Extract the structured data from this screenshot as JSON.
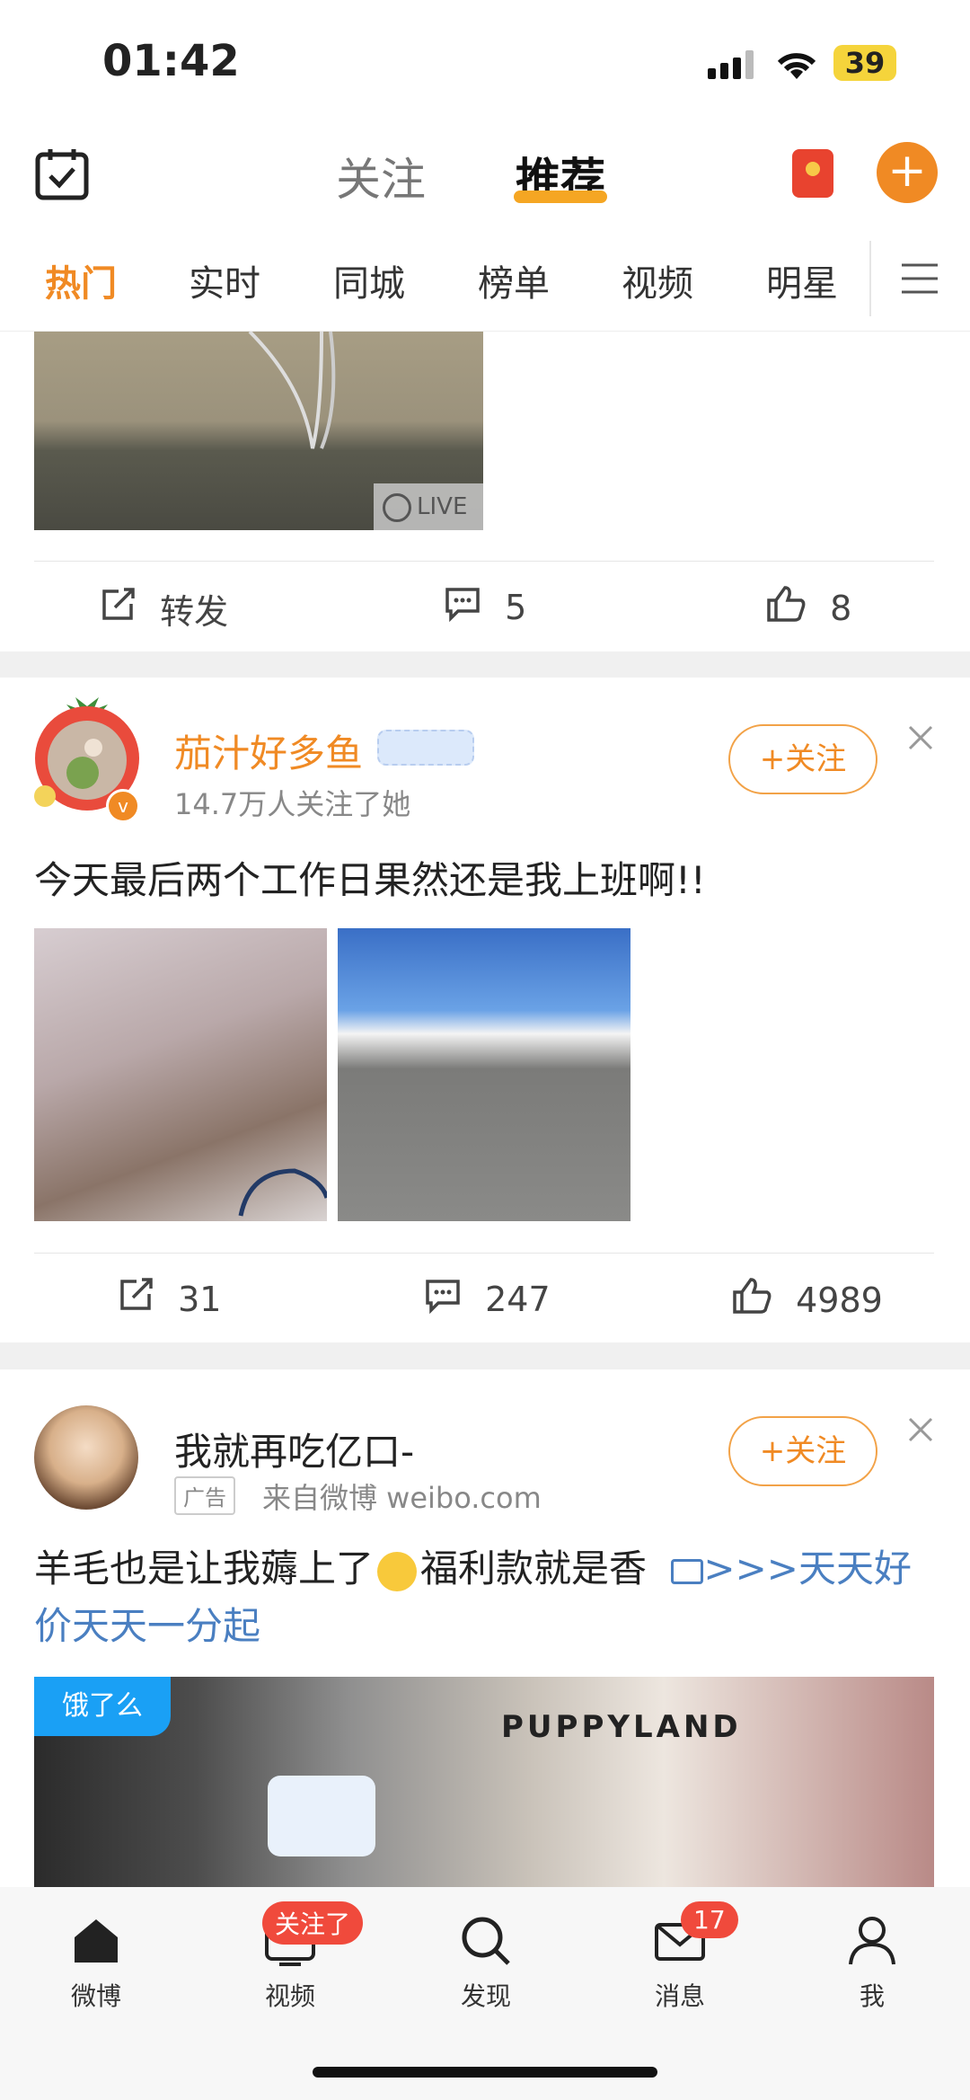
{
  "status": {
    "time": "01:42",
    "battery": "39"
  },
  "header": {
    "tab_follow": "关注",
    "tab_recommend": "推荐",
    "accent": "#f08a24"
  },
  "channels": [
    "热门",
    "实时",
    "同城",
    "榜单",
    "视频",
    "明星"
  ],
  "post1": {
    "live_label": "LIVE",
    "repost": "转发",
    "comments": "5",
    "likes": "8"
  },
  "post2": {
    "user": "茄汁好多鱼",
    "meta": "14.7万人关注了她",
    "follow": "+关注",
    "text": "今天最后两个工作日果然还是我上班啊!!",
    "reposts": "31",
    "comments": "247",
    "likes": "4989"
  },
  "post3": {
    "user": "我就再吃亿口-",
    "ad_tag": "广告",
    "source": "来自微博 weibo.com",
    "follow": "+关注",
    "text_a": "羊毛也是让我薅上了",
    "text_b": "福利款就是香",
    "link_text": ">>>天天好价天天一分起",
    "ad_brand": "饿了么",
    "bag_text": "PUPPYLAND"
  },
  "nav": {
    "home": "微博",
    "video": "视频",
    "video_badge": "关注了",
    "discover": "发现",
    "messages": "消息",
    "messages_badge": "17",
    "me": "我"
  }
}
